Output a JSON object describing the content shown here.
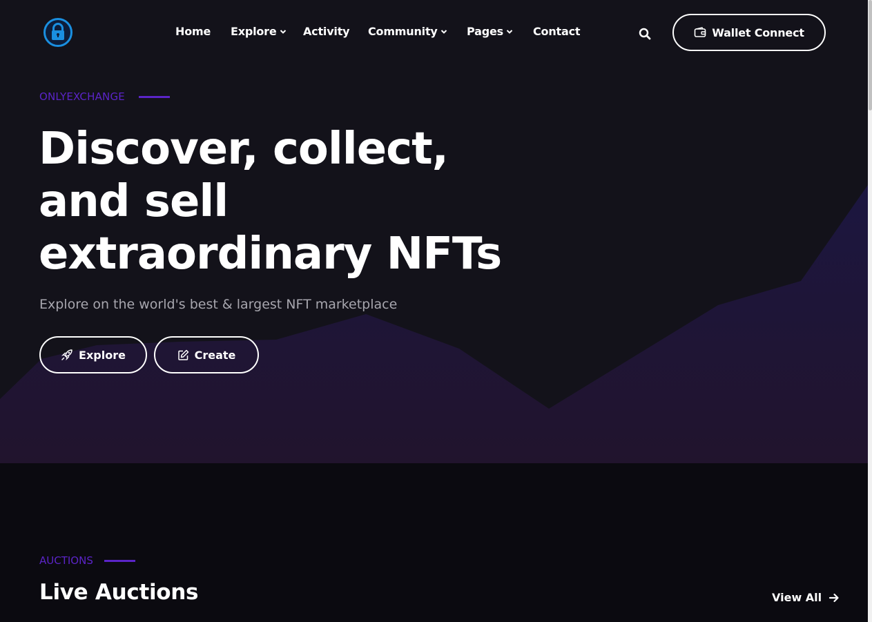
{
  "header": {
    "logo_icon": "lock-logo-icon",
    "nav": [
      {
        "label": "Home",
        "has_caret": false
      },
      {
        "label": "Explore",
        "has_caret": true
      },
      {
        "label": "Activity",
        "has_caret": false
      },
      {
        "label": "Community",
        "has_caret": true
      },
      {
        "label": "Pages",
        "has_caret": true
      },
      {
        "label": "Contact",
        "has_caret": false
      }
    ],
    "search_icon": "search-icon",
    "wallet_label": "Wallet Connect",
    "wallet_icon": "wallet-icon"
  },
  "hero": {
    "eyebrow": "ONLYEXCHANGE",
    "headline": [
      "Discover, collect,",
      "and sell",
      "extraordinary NFTs"
    ],
    "subtitle": "Explore on the world's best & largest NFT marketplace",
    "explore_label": "Explore",
    "explore_icon": "rocket-icon",
    "create_label": "Create",
    "create_icon": "edit-icon"
  },
  "auctions": {
    "eyebrow": "AUCTIONS",
    "title": "Live Auctions",
    "view_all_label": "View All",
    "view_all_icon": "arrow-right-icon"
  },
  "colors": {
    "accent": "#5b24c8",
    "hero_bg": "#13121a",
    "page_bg": "#0b0a10",
    "logo_blue": "#1a8fe0"
  }
}
